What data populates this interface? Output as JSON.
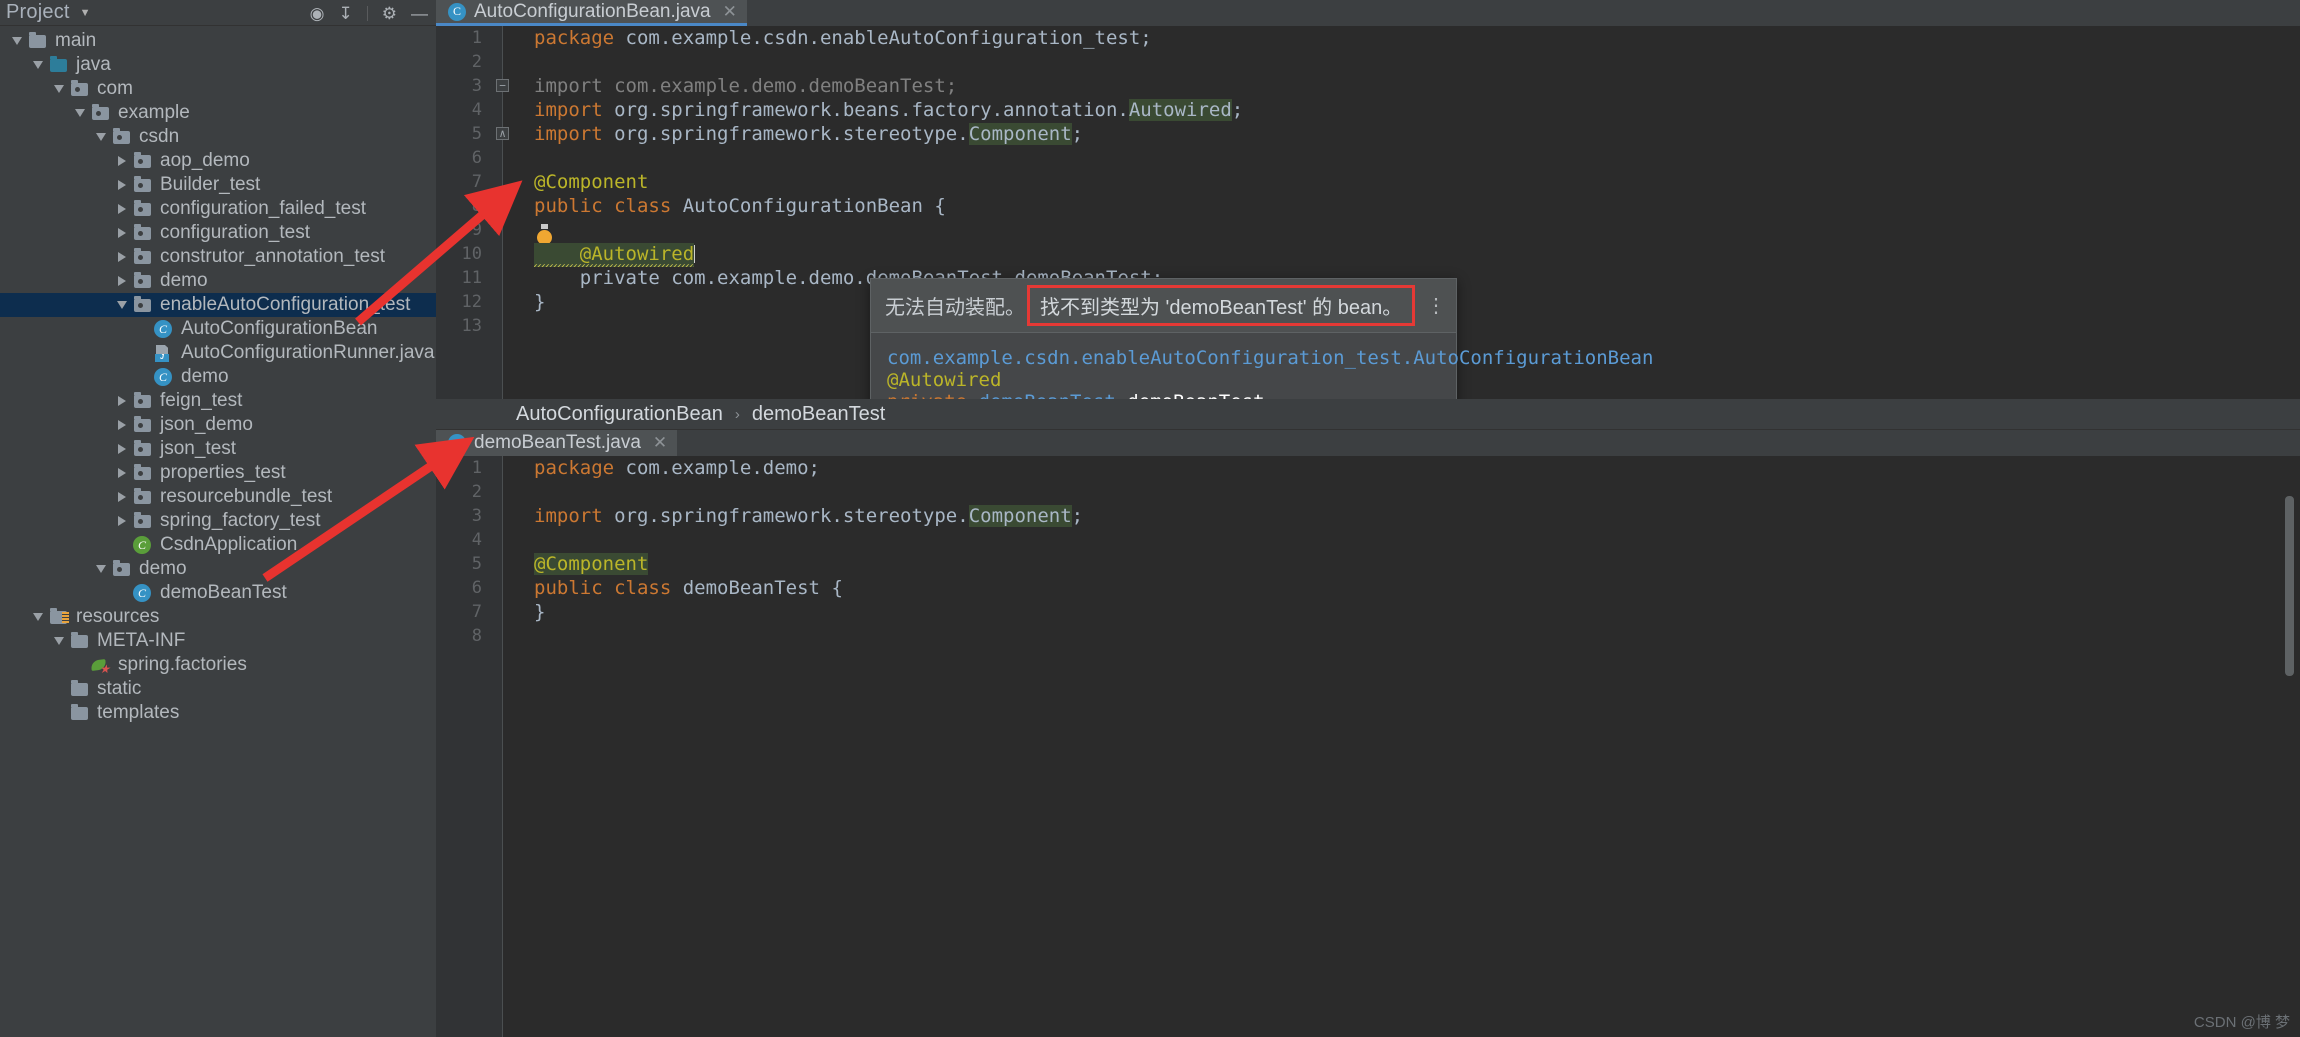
{
  "sidebar": {
    "title": "Project",
    "caret_icon": "chevron-down-icon",
    "toolbar_icons": [
      "locate-icon",
      "collapse-all-icon",
      "settings-gear-icon",
      "minimize-icon"
    ],
    "tree": [
      {
        "label": "main",
        "indent": 1,
        "arrow": "down",
        "icon": "folder-plain",
        "selected": false
      },
      {
        "label": "java",
        "indent": 2,
        "arrow": "down",
        "icon": "folder-blue",
        "selected": false
      },
      {
        "label": "com",
        "indent": 3,
        "arrow": "down",
        "icon": "folder-package",
        "selected": false
      },
      {
        "label": "example",
        "indent": 4,
        "arrow": "down",
        "icon": "folder-package",
        "selected": false
      },
      {
        "label": "csdn",
        "indent": 5,
        "arrow": "down",
        "icon": "folder-package",
        "selected": false
      },
      {
        "label": "aop_demo",
        "indent": 6,
        "arrow": "right",
        "icon": "folder-package",
        "selected": false
      },
      {
        "label": "Builder_test",
        "indent": 6,
        "arrow": "right",
        "icon": "folder-package",
        "selected": false
      },
      {
        "label": "configuration_failed_test",
        "indent": 6,
        "arrow": "right",
        "icon": "folder-package",
        "selected": false
      },
      {
        "label": "configuration_test",
        "indent": 6,
        "arrow": "right",
        "icon": "folder-package",
        "selected": false
      },
      {
        "label": "construtor_annotation_test",
        "indent": 6,
        "arrow": "right",
        "icon": "folder-package",
        "selected": false
      },
      {
        "label": "demo",
        "indent": 6,
        "arrow": "right",
        "icon": "folder-package",
        "selected": false
      },
      {
        "label": "enableAutoConfiguration_test",
        "indent": 6,
        "arrow": "down",
        "icon": "folder-package",
        "selected": true
      },
      {
        "label": "AutoConfigurationBean",
        "indent": 7,
        "arrow": "none",
        "icon": "java-class",
        "selected": false
      },
      {
        "label": "AutoConfigurationRunner.java",
        "indent": 7,
        "arrow": "none",
        "icon": "java-file",
        "selected": false
      },
      {
        "label": "demo",
        "indent": 7,
        "arrow": "none",
        "icon": "java-class",
        "selected": false
      },
      {
        "label": "feign_test",
        "indent": 6,
        "arrow": "right",
        "icon": "folder-package",
        "selected": false
      },
      {
        "label": "json_demo",
        "indent": 6,
        "arrow": "right",
        "icon": "folder-package",
        "selected": false
      },
      {
        "label": "json_test",
        "indent": 6,
        "arrow": "right",
        "icon": "folder-package",
        "selected": false
      },
      {
        "label": "properties_test",
        "indent": 6,
        "arrow": "right",
        "icon": "folder-package",
        "selected": false
      },
      {
        "label": "resourcebundle_test",
        "indent": 6,
        "arrow": "right",
        "icon": "folder-package",
        "selected": false
      },
      {
        "label": "spring_factory_test",
        "indent": 6,
        "arrow": "right",
        "icon": "folder-package",
        "selected": false
      },
      {
        "label": "CsdnApplication",
        "indent": 6,
        "arrow": "none",
        "icon": "spring-class",
        "selected": false
      },
      {
        "label": "demo",
        "indent": 5,
        "arrow": "down",
        "icon": "folder-package",
        "selected": false
      },
      {
        "label": "demoBeanTest",
        "indent": 6,
        "arrow": "none",
        "icon": "java-class",
        "selected": false
      },
      {
        "label": "resources",
        "indent": 2,
        "arrow": "down",
        "icon": "folder-resources",
        "selected": false
      },
      {
        "label": "META-INF",
        "indent": 3,
        "arrow": "down",
        "icon": "folder-plain",
        "selected": false
      },
      {
        "label": "spring.factories",
        "indent": 4,
        "arrow": "none",
        "icon": "spring-leaf",
        "selected": false
      },
      {
        "label": "static",
        "indent": 3,
        "arrow": "none",
        "icon": "folder-plain",
        "selected": false
      },
      {
        "label": "templates",
        "indent": 3,
        "arrow": "none",
        "icon": "folder-plain",
        "selected": false
      }
    ]
  },
  "top_editor": {
    "tab": {
      "name": "AutoConfigurationBean.java",
      "icon": "java-class-icon",
      "close_icon": "close-icon"
    },
    "lines": [
      {
        "no": "1",
        "gutter": "",
        "segments": [
          {
            "t": "package ",
            "c": "kw"
          },
          {
            "t": "com.example.csdn.enableAutoConfiguration_test;",
            "c": "pl"
          }
        ]
      },
      {
        "no": "2",
        "gutter": "",
        "segments": []
      },
      {
        "no": "3",
        "gutter": "",
        "fold": "minus",
        "segments": [
          {
            "t": "import com.example.demo.demoBeanTest;",
            "c": "grey"
          }
        ]
      },
      {
        "no": "4",
        "gutter": "",
        "segments": [
          {
            "t": "import ",
            "c": "kw"
          },
          {
            "t": "org.springframework.beans.factory.annotation.",
            "c": "pl"
          },
          {
            "t": "Autowired",
            "c": "hl-green"
          },
          {
            "t": ";",
            "c": "pl"
          }
        ]
      },
      {
        "no": "5",
        "gutter": "",
        "fold": "plus",
        "segments": [
          {
            "t": "import ",
            "c": "kw"
          },
          {
            "t": "org.springframework.stereotype.",
            "c": "pl"
          },
          {
            "t": "Component",
            "c": "hl-green"
          },
          {
            "t": ";",
            "c": "pl"
          }
        ]
      },
      {
        "no": "6",
        "gutter": "",
        "segments": []
      },
      {
        "no": "7",
        "gutter": "",
        "segments": [
          {
            "t": "@Component",
            "c": "ann"
          }
        ]
      },
      {
        "no": "8",
        "gutter": "spring-bean-icon",
        "segments": [
          {
            "t": "public class ",
            "c": "kw"
          },
          {
            "t": "AutoConfigurationBean ",
            "c": "pl"
          },
          {
            "t": "{",
            "c": "pl"
          }
        ]
      },
      {
        "no": "9",
        "gutter": "",
        "bulb": true,
        "segments": []
      },
      {
        "no": "10",
        "gutter": "",
        "segments": [
          {
            "t": "    @Autowired",
            "c": "ann-warn"
          }
        ]
      },
      {
        "no": "11",
        "gutter": "",
        "segments": [
          {
            "t": "    private com.example.demo.demoBeanTest ",
            "c": "pl"
          },
          {
            "t": "demoBeanTest",
            "c": "err"
          },
          {
            "t": ";",
            "c": "pl"
          }
        ]
      },
      {
        "no": "12",
        "gutter": "",
        "segments": [
          {
            "t": "}",
            "c": "pl"
          }
        ]
      },
      {
        "no": "13",
        "gutter": "",
        "segments": []
      }
    ]
  },
  "popup": {
    "header_prefix": "无法自动装配。",
    "header_message": "找不到类型为 'demoBeanTest' 的 bean。",
    "kebab_icon": "more-options-icon",
    "body": {
      "fqn": "com.example.csdn.enableAutoConfiguration_test.AutoConfigurationBean",
      "annotation": "@Autowired",
      "declaration_keyword": "private",
      "declaration_type": "demoBeanTest",
      "declaration_name": "demoBeanTest"
    },
    "footer_kebab_icon": "more-options-icon",
    "highlight_color": "#e53935"
  },
  "breadcrumb": {
    "class": "AutoConfigurationBean",
    "member": "demoBeanTest",
    "separator": "›"
  },
  "bottom_editor": {
    "tab": {
      "name": "demoBeanTest.java",
      "icon": "java-class-icon",
      "close_icon": "close-icon"
    },
    "lines": [
      {
        "no": "1",
        "segments": [
          {
            "t": "package ",
            "c": "kw"
          },
          {
            "t": "com.example.demo;",
            "c": "pl"
          }
        ]
      },
      {
        "no": "2",
        "segments": []
      },
      {
        "no": "3",
        "segments": [
          {
            "t": "import ",
            "c": "kw"
          },
          {
            "t": "org.springframework.stereotype.",
            "c": "pl"
          },
          {
            "t": "Component",
            "c": "hl-green"
          },
          {
            "t": ";",
            "c": "pl"
          }
        ]
      },
      {
        "no": "4",
        "segments": []
      },
      {
        "no": "5",
        "segments": [
          {
            "t": "@Component",
            "c": "ann-hl"
          }
        ]
      },
      {
        "no": "6",
        "segments": [
          {
            "t": "public class ",
            "c": "kw"
          },
          {
            "t": "demoBeanTest ",
            "c": "pl"
          },
          {
            "t": "{",
            "c": "pl"
          }
        ]
      },
      {
        "no": "7",
        "segments": [
          {
            "t": "}",
            "c": "pl"
          }
        ]
      },
      {
        "no": "8",
        "segments": []
      }
    ]
  },
  "watermark": "CSDN @博 梦",
  "annotations": {
    "arrow1_label": "arrow-to-autoconfigurationbean",
    "arrow2_label": "arrow-to-demobeantest-tab",
    "color": "#e8332f"
  }
}
